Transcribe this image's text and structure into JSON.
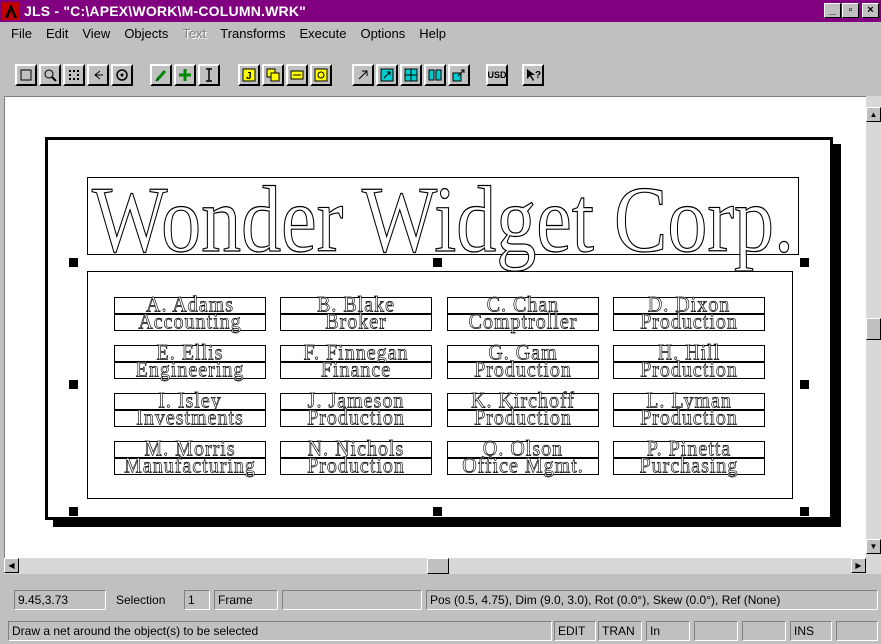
{
  "window": {
    "title": "JLS - \"C:\\APEX\\WORK\\M-COLUMN.WRK\"",
    "buttons": {
      "minimize": "_",
      "maximize": "▫",
      "close": "×"
    }
  },
  "menu": [
    {
      "label": "File",
      "disabled": false
    },
    {
      "label": "Edit",
      "disabled": false
    },
    {
      "label": "View",
      "disabled": false
    },
    {
      "label": "Objects",
      "disabled": false
    },
    {
      "label": "Text",
      "disabled": true
    },
    {
      "label": "Transforms",
      "disabled": false
    },
    {
      "label": "Execute",
      "disabled": false
    },
    {
      "label": "Options",
      "disabled": false
    },
    {
      "label": "Help",
      "disabled": false
    }
  ],
  "toolbar": {
    "usd_label": "USD",
    "icons": [
      "select-rect-icon",
      "zoom-icon",
      "grid-icon",
      "back-icon",
      "view-icon",
      "pencil-icon",
      "plus-icon",
      "text-cursor-icon",
      "frame-j-icon",
      "copy-icon",
      "bar-icon",
      "circle-icon",
      "arrow-ne-icon",
      "box-arrow-icon",
      "split-icon",
      "columns-icon",
      "export-icon",
      "usd-icon",
      "help-cursor-icon"
    ]
  },
  "document": {
    "headline": "Wonder Widget Corp.",
    "rows": [
      [
        [
          "A. Adams",
          "Accounting"
        ],
        [
          "B. Blake",
          "Broker"
        ],
        [
          "C. Chan",
          "Comptroller"
        ],
        [
          "D. Dixon",
          "Production"
        ]
      ],
      [
        [
          "E. Ellis",
          "Engineering"
        ],
        [
          "F. Finnegan",
          "Finance"
        ],
        [
          "G. Gam",
          "Production"
        ],
        [
          "H. Hill",
          "Production"
        ]
      ],
      [
        [
          "I. Isley",
          "Investments"
        ],
        [
          "J. Jameson",
          "Production"
        ],
        [
          "K. Kirchoff",
          "Production"
        ],
        [
          "L. Lyman",
          "Production"
        ]
      ],
      [
        [
          "M. Morris",
          "Manufacturing"
        ],
        [
          "N. Nichols",
          "Production"
        ],
        [
          "O. Olson",
          "Office Mgmt."
        ],
        [
          "P. Pinetta",
          "Purchasing"
        ]
      ]
    ]
  },
  "status": {
    "coords": "9.45,3.73",
    "selection_label": "Selection",
    "selection_count": "1",
    "object_type": "Frame",
    "info": "Pos (0.5, 4.75), Dim (9.0, 3.0), Rot (0.0°), Skew (0.0°), Ref (None)",
    "hint": "Draw a net around the object(s) to be selected",
    "modes": [
      "EDIT",
      "TRAN",
      "In",
      "",
      "",
      "",
      "INS",
      ""
    ]
  }
}
